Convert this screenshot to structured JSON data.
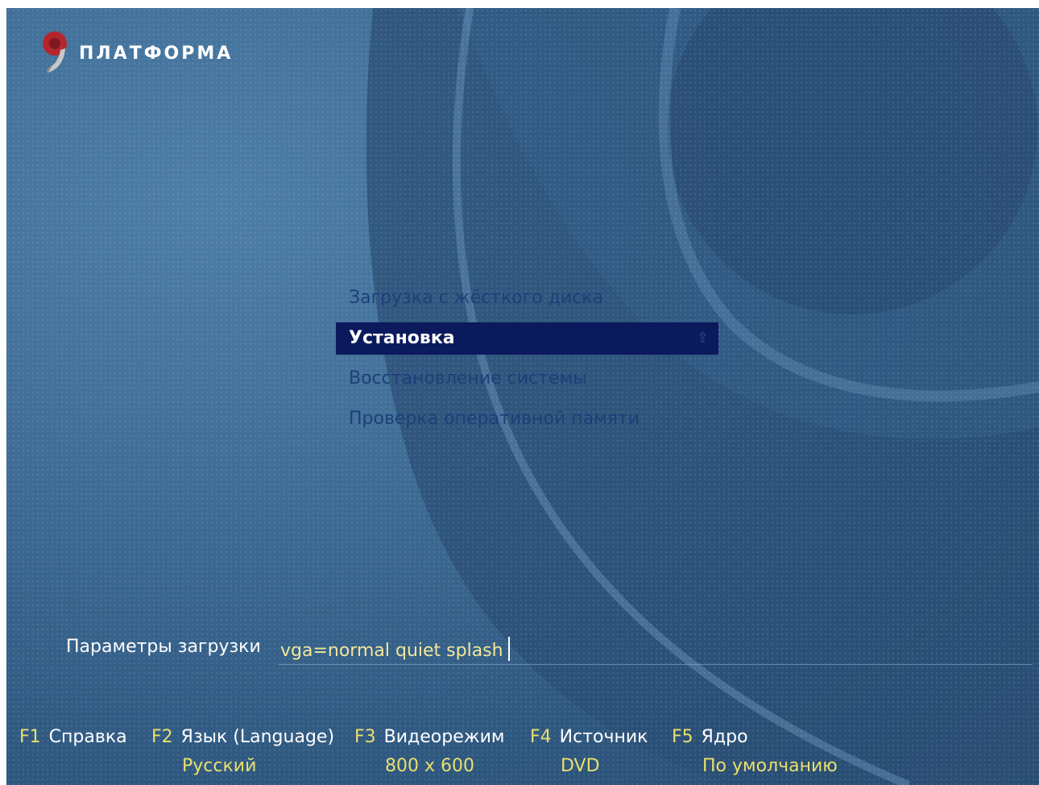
{
  "logo": {
    "text": "ПЛАТФОРМА"
  },
  "colors": {
    "background": "#3f6d96",
    "menu_text": "#1f3f78",
    "selected_bg": "#0b1a5c",
    "accent_yellow": "#e9df6e",
    "logo_red": "#b5262c"
  },
  "menu": {
    "items": [
      {
        "label": "Загрузка с жёсткого диска"
      },
      {
        "label": "Установка"
      },
      {
        "label": "Восстановление системы"
      },
      {
        "label": "Проверка оперативной памяти"
      }
    ],
    "selected_index": 1,
    "selected_glyph": "⇪"
  },
  "boot_params": {
    "label": "Параметры загрузки",
    "value": "vga=normal quiet splash"
  },
  "function_keys": [
    {
      "key": "F1",
      "label": "Справка",
      "value": ""
    },
    {
      "key": "F2",
      "label": "Язык (Language)",
      "value": "Русский"
    },
    {
      "key": "F3",
      "label": "Видеорежим",
      "value": "800 x 600"
    },
    {
      "key": "F4",
      "label": "Источник",
      "value": "DVD"
    },
    {
      "key": "F5",
      "label": "Ядро",
      "value": "По умолчанию"
    }
  ]
}
